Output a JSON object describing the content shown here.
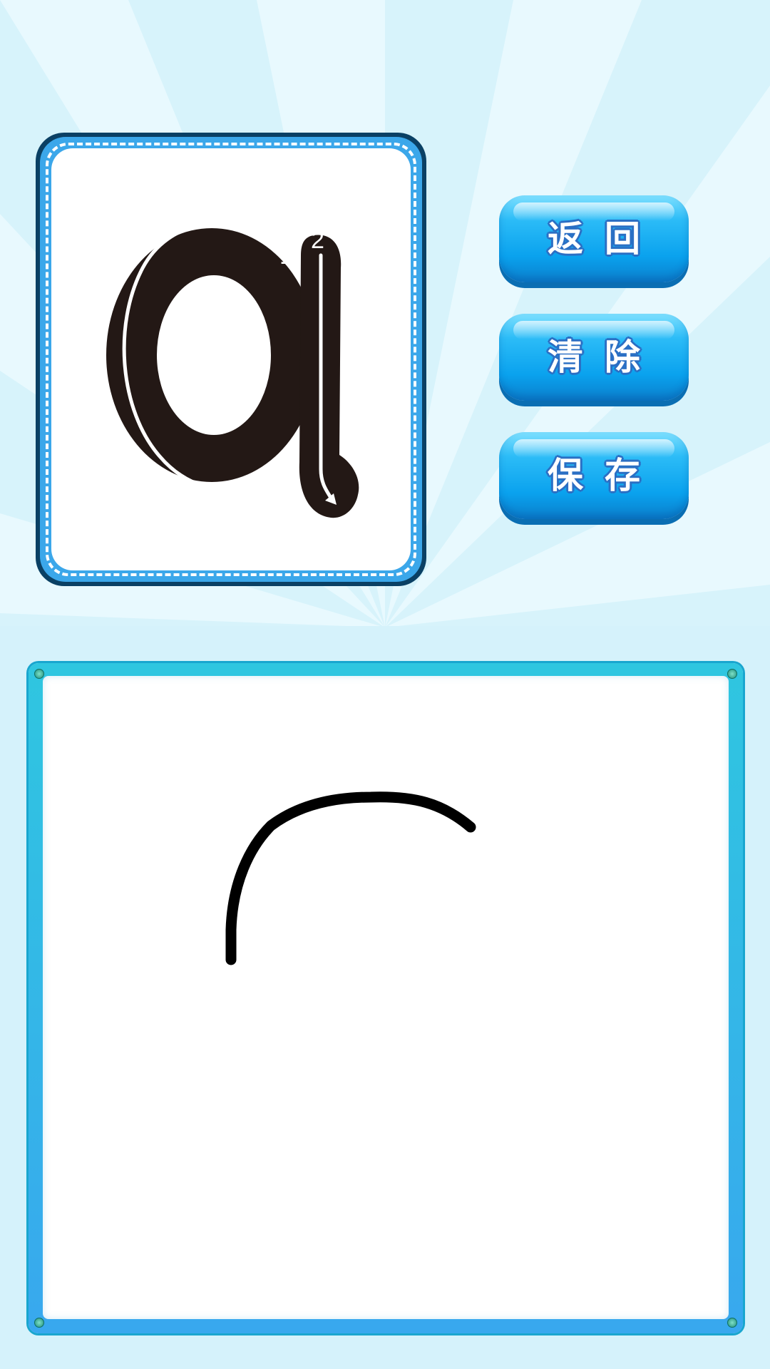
{
  "letter_card": {
    "letter": "a",
    "stroke_numbers": [
      "1",
      "2"
    ]
  },
  "buttons": {
    "back_label": "返回",
    "clear_label": "清除",
    "save_label": "保存"
  },
  "colors": {
    "background": "#d7f3fb",
    "card_border": "#0a4064",
    "card_ring": "#3ba7ea",
    "button_blue": "#0aa2ee",
    "board_frame": "#2fc6e0",
    "ink": "#000000"
  },
  "icons": [
    "stroke-direction-arrow-icon",
    "board-screw-icon"
  ]
}
